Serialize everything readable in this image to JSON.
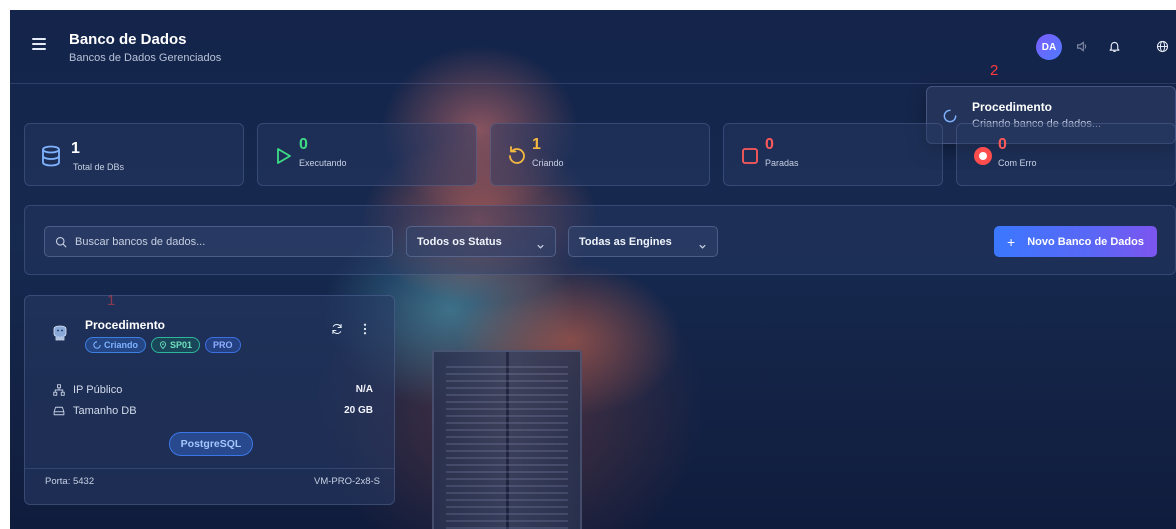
{
  "header": {
    "title": "Banco de Dados",
    "subtitle": "Bancos de Dados Gerenciados",
    "avatar_initials": "DA"
  },
  "markers": {
    "one": "1",
    "two": "2"
  },
  "toast": {
    "title": "Procedimento",
    "message": "Criando banco de dados..."
  },
  "stats": [
    {
      "value": "1",
      "label": "Total de DBs",
      "color": "#7fb3ff"
    },
    {
      "value": "0",
      "label": "Executando",
      "color": "#3ddc84"
    },
    {
      "value": "1",
      "label": "Criando",
      "color": "#f5b942"
    },
    {
      "value": "0",
      "label": "Paradas",
      "color": "#ff5a5a"
    },
    {
      "value": "0",
      "label": "Com Erro",
      "color": "#ff5a5a"
    }
  ],
  "filters": {
    "search_placeholder": "Buscar bancos de dados...",
    "status_select": "Todos os Status",
    "engine_select": "Todas as Engines",
    "new_button": "Novo Banco de Dados"
  },
  "database": {
    "name": "Procedimento",
    "status_badge": "Criando",
    "region_badge": "SP01",
    "plan_badge": "PRO",
    "ip_label": "IP Público",
    "ip_value": "N/A",
    "size_label": "Tamanho DB",
    "size_value": "20 GB",
    "engine": "PostgreSQL",
    "port": "Porta: 5432",
    "vm": "VM-PRO-2x8-S"
  }
}
